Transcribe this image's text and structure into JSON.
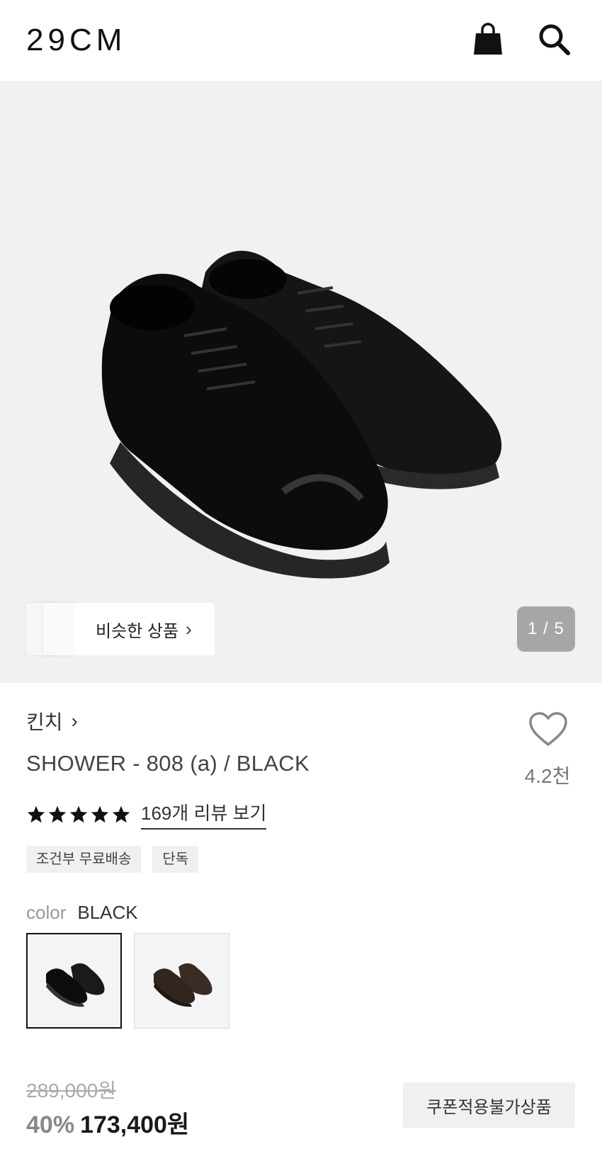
{
  "header": {
    "logo": "29CM",
    "icons": {
      "bag": "shopping-bag-icon",
      "search": "search-icon"
    }
  },
  "gallery": {
    "similar_label": "비슷한 상품",
    "chevron": "›",
    "counter": "1 / 5"
  },
  "product": {
    "brand": "킨치",
    "brand_chevron": "›",
    "title": "SHOWER - 808 (a) / BLACK",
    "like_count": "4.2천",
    "rating": {
      "stars": 5,
      "review_link": "169개 리뷰 보기"
    },
    "tags": [
      "조건부 무료배송",
      "단독"
    ],
    "color": {
      "label": "color",
      "value": "BLACK",
      "options": [
        "BLACK",
        "BROWN"
      ]
    },
    "price": {
      "original": "289,000원",
      "discount": "40%",
      "sale": "173,400원"
    },
    "coupon_label": "쿠폰적용불가상품"
  },
  "colors": {
    "star": "#111111",
    "counter_bg": "#a6a6a6",
    "tag_bg": "#f0f0f0"
  }
}
